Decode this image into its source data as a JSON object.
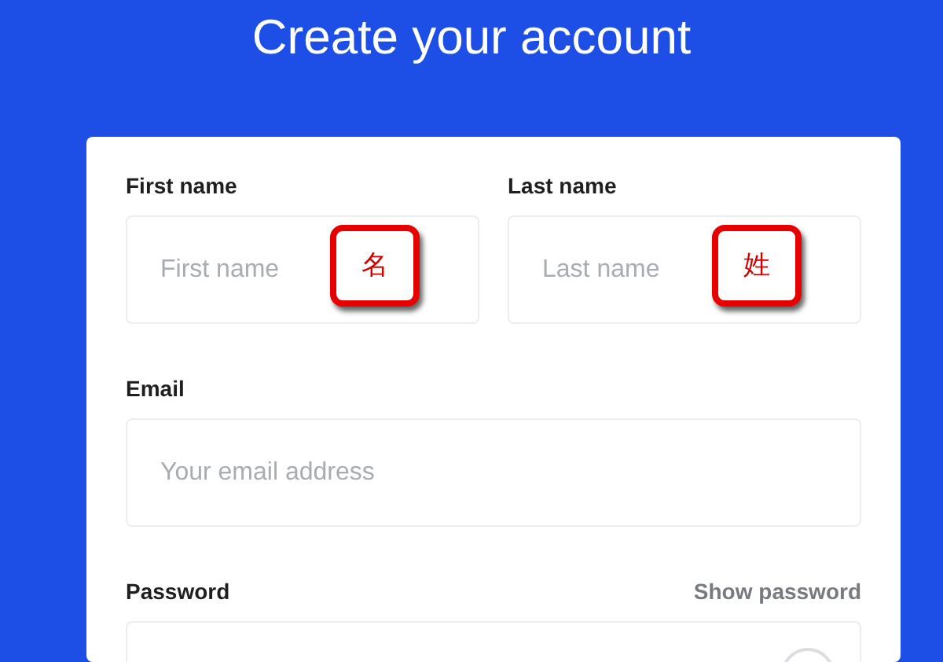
{
  "title": "Create your account",
  "name_fields": [
    {
      "label": "First name",
      "placeholder": "First name",
      "annotation": "名"
    },
    {
      "label": "Last name",
      "placeholder": "Last name",
      "annotation": "姓"
    }
  ],
  "email": {
    "label": "Email",
    "placeholder": "Your email address"
  },
  "password": {
    "label": "Password",
    "toggle": "Show password"
  }
}
